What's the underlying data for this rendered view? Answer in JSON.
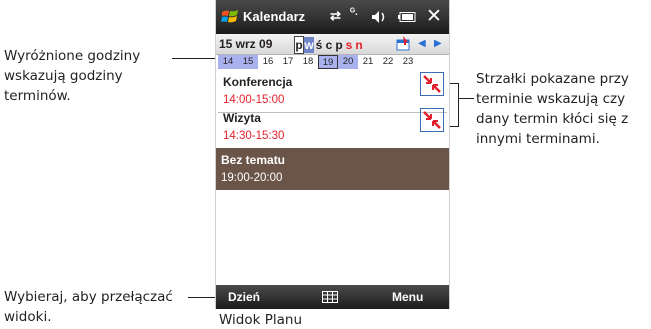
{
  "annotations": {
    "hours_note": [
      "Wyróżnione godziny",
      "wskazują godziny",
      "terminów."
    ],
    "conflict_note": [
      "Strzałki pokazane przy",
      "terminie wskazują czy",
      "dany termin kłóci się z",
      "innymi terminami."
    ],
    "switch_note": [
      "Wybieraj, aby przełączać",
      "widoki."
    ]
  },
  "caption": "Widok Planu",
  "titlebar": {
    "title": "Kalendarz",
    "icons": [
      "windows-logo-icon",
      "sync-arrows-icon",
      "signal-icon",
      "volume-icon",
      "battery-icon",
      "close-icon"
    ],
    "close": "✕"
  },
  "datebar": {
    "date": "15 wrz 09",
    "days": [
      "p",
      "w",
      "ś",
      "c",
      "p",
      "s",
      "n"
    ],
    "selected_day_index": 0,
    "weekend_day_indices": [
      5,
      6
    ],
    "prev": "◀",
    "next": "▶"
  },
  "hours": {
    "labels": [
      "14",
      "15",
      "16",
      "17",
      "18",
      "19",
      "20",
      "21",
      "22",
      "23"
    ],
    "highlighted": [
      "14",
      "15",
      "19",
      "20"
    ],
    "current": "19"
  },
  "appointments": [
    {
      "name": "Konferencja",
      "time": "14:00-15:00",
      "conflict": true,
      "tentative": false
    },
    {
      "name": "Wizyta",
      "time": "14:30-15:30",
      "conflict": true,
      "tentative": false
    },
    {
      "name": "Bez tematu",
      "time": "19:00-20:00",
      "conflict": false,
      "tentative": true
    }
  ],
  "softbar": {
    "left": "Dzień",
    "middle_icon": "calendar-grid-icon",
    "right": "Menu"
  },
  "colors": {
    "bar_dark": "#2b2b2b",
    "highlight": "#a9b2ee",
    "week_day": "#6f83c9",
    "time_text": "#e4212b",
    "tentative_bg": "#6b5549",
    "conflict_box": "#3a6fb5"
  }
}
